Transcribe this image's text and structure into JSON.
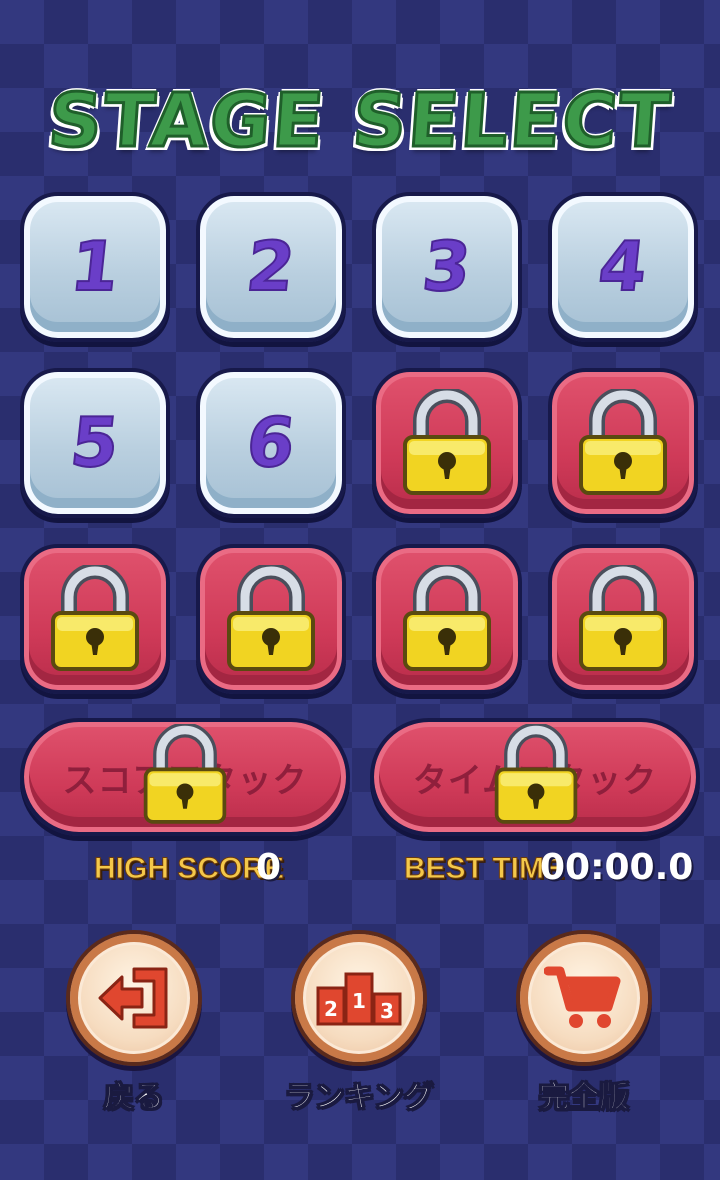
{
  "title": "STAGE SELECT",
  "stages": [
    {
      "label": "1",
      "locked": false
    },
    {
      "label": "2",
      "locked": false
    },
    {
      "label": "3",
      "locked": false
    },
    {
      "label": "4",
      "locked": false
    },
    {
      "label": "5",
      "locked": false
    },
    {
      "label": "6",
      "locked": false
    },
    {
      "label": "",
      "locked": true
    },
    {
      "label": "",
      "locked": true
    },
    {
      "label": "",
      "locked": true
    },
    {
      "label": "",
      "locked": true
    },
    {
      "label": "",
      "locked": true
    },
    {
      "label": "",
      "locked": true
    }
  ],
  "modes": {
    "score_attack": {
      "label": "スコアアタック",
      "locked": true
    },
    "time_attack": {
      "label": "タイムアタック",
      "locked": true
    }
  },
  "stats": {
    "high_score_label": "HIGH SCORE",
    "high_score_value": "0",
    "best_time_label": "BEST TIME",
    "best_time_value": "00:00.0"
  },
  "buttons": {
    "back_label": "戻る",
    "back_icon": "exit-door-icon",
    "ranking_label": "ランキング",
    "ranking_icon": "podium-icon",
    "ranking_podium": [
      "2",
      "1",
      "3"
    ],
    "full_version_label": "完全版",
    "full_version_icon": "shopping-cart-icon"
  },
  "colors": {
    "title_green": "#3d9a4a",
    "number_purple": "#6a3ec8",
    "locked_red": "#cf3a58",
    "stat_label_yellow": "#f4c84a",
    "icon_red": "#e0472f"
  }
}
